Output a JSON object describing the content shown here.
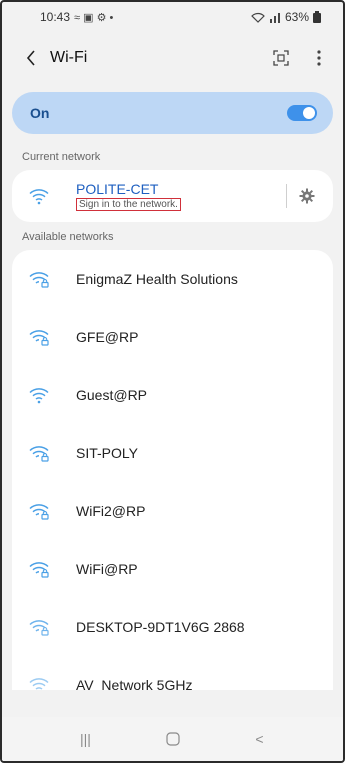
{
  "statusbar": {
    "time": "10:43",
    "left_icons": "≈ ▣ ⚙ •",
    "right_text": "63%"
  },
  "header": {
    "title": "Wi-Fi",
    "qr_icon": "qr-scan-icon",
    "more_icon": "more-vert-icon"
  },
  "toggle": {
    "label": "On",
    "state": true,
    "accent": "#3e91ea"
  },
  "current": {
    "section_label": "Current network",
    "name": "POLITE-CET",
    "status": "Sign in to the network.",
    "highlight_color": "#d0303a"
  },
  "available": {
    "section_label": "Available networks",
    "networks": [
      {
        "name": "EnigmaZ Health Solutions",
        "locked": true
      },
      {
        "name": "GFE@RP",
        "locked": true
      },
      {
        "name": "Guest@RP",
        "locked": false
      },
      {
        "name": "SIT-POLY",
        "locked": true
      },
      {
        "name": "WiFi2@RP",
        "locked": true
      },
      {
        "name": "WiFi@RP",
        "locked": true
      },
      {
        "name": "DESKTOP-9DT1V6G 2868",
        "locked": true
      },
      {
        "name": "AV_Network 5GHz",
        "locked": false
      }
    ]
  },
  "navbar": {
    "recent": "|||",
    "home": "▢",
    "back": "<"
  }
}
